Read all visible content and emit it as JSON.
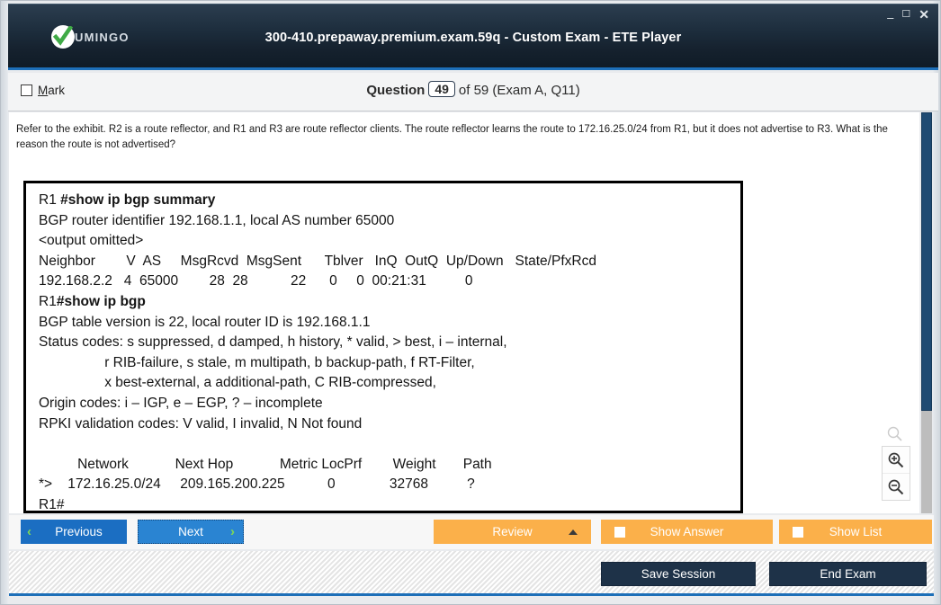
{
  "window": {
    "title": "300-410.prepaway.premium.exam.59q - Custom Exam - ETE Player",
    "minimize_label": "–",
    "maximize_label": "☐",
    "close_label": "✕",
    "brand_text": "UMINGO"
  },
  "question_bar": {
    "mark_accel": "M",
    "mark_label": "ark",
    "question_word": "Question",
    "question_number": "49",
    "of_text": "of 59 (Exam A, Q11)"
  },
  "content": {
    "question_text": "Refer to the exhibit. R2 is a route reflector, and R1 and R3 are route reflector clients. The route reflector learns the route to 172.16.25.0/24 from R1, but it does not advertise to R3. What is the reason the route is not advertised?",
    "exhibit": {
      "line_r1_prompt": "R1 ",
      "line_r1_cmd": "#show ip bgp summary",
      "line_identifier": "BGP router identifier 192.168.1.1, local AS number 65000",
      "line_omitted": "<output omitted>",
      "summary_header": "Neighbor        V  AS     MsgRcvd  MsgSent      Tblver   InQ  OutQ  Up/Down   State/PfxRcd",
      "summary_row": "192.168.2.2   4  65000        28  28           22      0     0  00:21:31          0",
      "line_r2_prompt": "R1",
      "line_r2_cmd": "#show ip bgp",
      "line_tableversion": "BGP table version is 22, local router ID is 192.168.1.1",
      "line_status1": "Status codes: s suppressed, d damped, h history, * valid, > best, i – internal,",
      "line_status2": "                 r RIB-failure, s stale, m multipath, b backup-path, f RT-Filter,",
      "line_status3": "                 x best-external, a additional-path, C RIB-compressed,",
      "line_origin": "Origin codes: i – IGP, e – EGP, ? – incomplete",
      "line_rpki": "RPKI validation codes: V valid, I invalid, N Not found",
      "line_blank": "",
      "routes_header": "          Network            Next Hop            Metric LocPrf        Weight       Path",
      "routes_row": "*>    172.16.25.0/24     209.165.200.225           0              32768          ?",
      "line_end_prompt": "R1#"
    },
    "zoom_tools": {
      "fit_icon": "magnifier-icon",
      "zoom_in_icon": "magnifier-plus-icon",
      "zoom_out_icon": "magnifier-minus-icon"
    }
  },
  "actions": {
    "previous_label": "Previous",
    "previous_chevron": "‹",
    "next_label": "Next",
    "next_chevron": "›",
    "review_label": "Review",
    "show_answer_label": "Show Answer",
    "show_list_label": "Show List"
  },
  "footer": {
    "save_session_label": "Save Session",
    "end_exam_label": "End Exam"
  },
  "colors": {
    "titlebar_dark": "#1b2b3a",
    "accent_blue": "#1d6fb8",
    "button_blue": "#1b6ec2",
    "button_blue_focus": "#2a84d2",
    "button_orange": "#fbb04a",
    "button_dark": "#1e3248",
    "brand_green": "#3faa46",
    "scrollbar_thumb": "#1f4a72"
  }
}
